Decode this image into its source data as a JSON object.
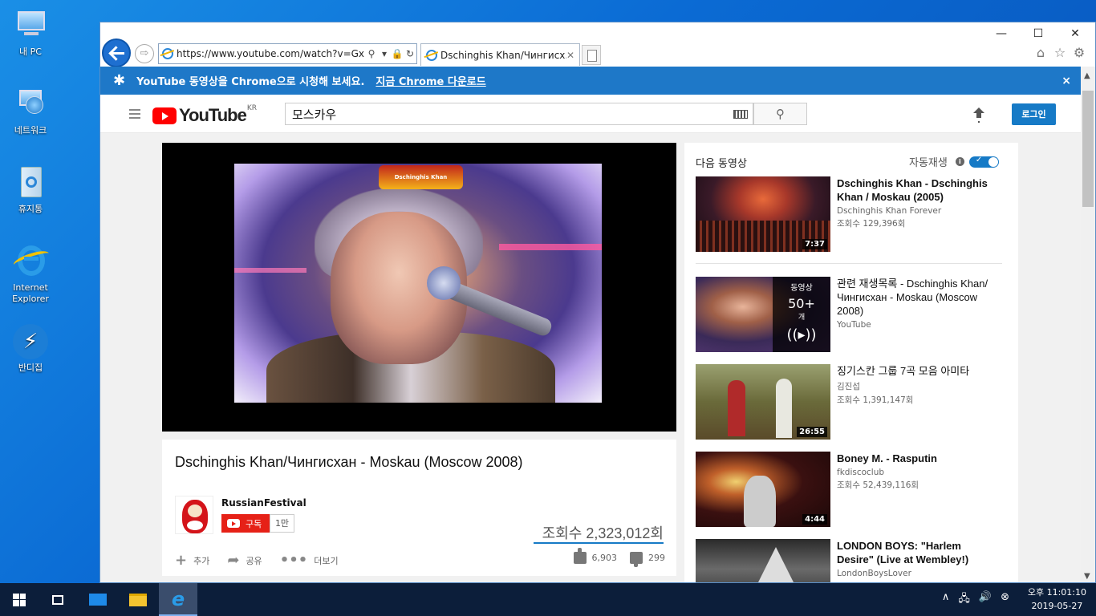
{
  "desktop": {
    "icons": [
      {
        "label": "내 PC",
        "icon": "pc-icon"
      },
      {
        "label": "네트워크",
        "icon": "network-icon"
      },
      {
        "label": "휴지통",
        "icon": "recycle-bin-icon"
      },
      {
        "label": "Internet Explorer",
        "icon": "ie-icon"
      },
      {
        "label": "반디집",
        "icon": "bandizip-icon"
      }
    ]
  },
  "browser": {
    "url": "https://www.youtube.com/watch?v=GxMg",
    "tab_title": "Dschinghis Khan/Чингисх...",
    "window_controls": {
      "minimize": "—",
      "maximize": "☐",
      "close": "✕"
    },
    "tools": {
      "home": "⌂",
      "favorites": "☆",
      "settings": "⚙"
    }
  },
  "banner": {
    "message": "YouTube 동영상을 Chrome으로 시청해 보세요.",
    "link": "지금 Chrome 다운로드",
    "close": "×"
  },
  "youtube": {
    "logo_text": "YouTube",
    "region": "KR",
    "search_value": "모스카우",
    "login_label": "로그인",
    "accent": "#ff0000"
  },
  "video": {
    "title": "Dschinghis Khan/Чингисхан - Moskau (Moscow 2008)",
    "channel": "RussianFestival",
    "subscribe_label": "구독",
    "subscriber_count": "1만",
    "views": "조회수 2,323,012회",
    "actions": {
      "add": "추가",
      "share": "공유",
      "more": "더보기"
    },
    "likes": "6,903",
    "dislikes": "299",
    "overlay_badge": "Dschinghis Khan"
  },
  "sidebar": {
    "up_next": "다음 동영상",
    "autoplay": "자동재생",
    "items": [
      {
        "title": "Dschinghis Khan - Dschinghis Khan / Moskau (2005)",
        "channel": "Dschinghis Khan Forever",
        "views": "조회수 129,396회",
        "duration": "7:37"
      },
      {
        "title": "관련 재생목록 - Dschinghis Khan/Чингисхан - Moskau (Moscow 2008)",
        "channel": "YouTube",
        "views": "",
        "playlist_label": "동영상",
        "playlist_count": "50+",
        "playlist_unit": "개"
      },
      {
        "title": "징기스칸 그룹 7곡 모음 아미타",
        "channel": "김진섭",
        "views": "조회수 1,391,147회",
        "duration": "26:55"
      },
      {
        "title": "Boney M. - Rasputin",
        "channel": "fkdiscoclub",
        "views": "조회수 52,439,116회",
        "duration": "4:44"
      },
      {
        "title": "LONDON BOYS: \"Harlem Desire\" (Live at Wembley!)",
        "channel": "LondonBoysLover",
        "views": "",
        "duration": ""
      }
    ]
  },
  "taskbar": {
    "clock_time": "오후 11:01:10",
    "clock_date": "2019-05-27"
  }
}
